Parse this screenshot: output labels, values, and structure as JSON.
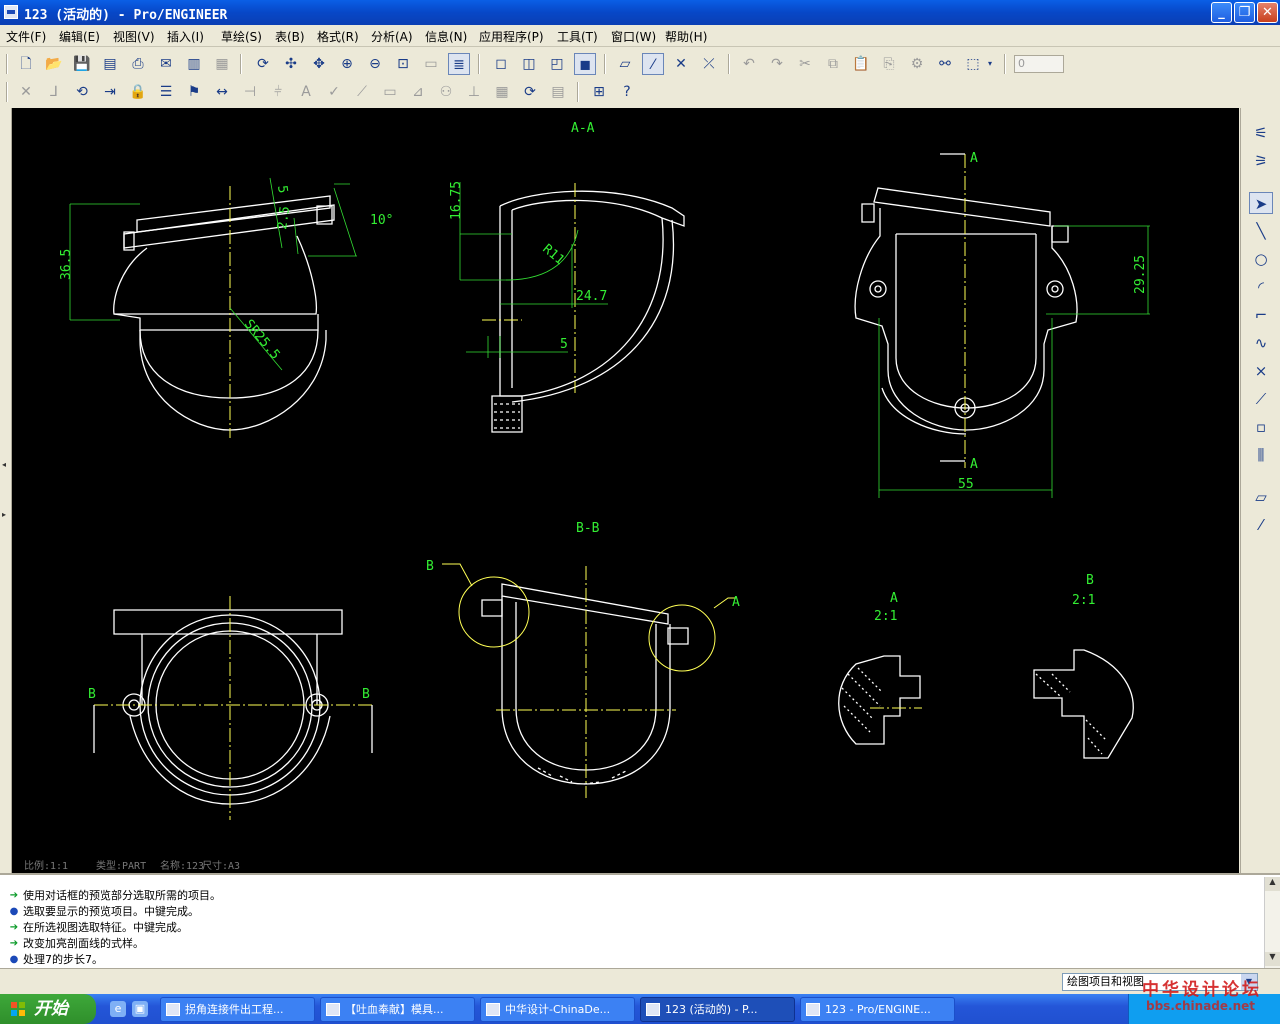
{
  "window": {
    "title": "123 (活动的) - Pro/ENGINEER"
  },
  "menu": [
    "文件(F)",
    "编辑(E)",
    "视图(V)",
    "插入(I)",
    "草绘(S)",
    "表(B)",
    "格式(R)",
    "分析(A)",
    "信息(N)",
    "应用程序(P)",
    "工具(T)",
    "窗口(W)",
    "帮助(H)"
  ],
  "toolbar": {
    "scale_spin_value": "0"
  },
  "drawing": {
    "views": {
      "top_left": {
        "dims": [
          "36.5",
          "5",
          "2.5",
          "10°",
          "SR25.5"
        ]
      },
      "section_aa": {
        "title": "A-A",
        "dims": [
          "16.75",
          "R11",
          "24.7",
          "5"
        ]
      },
      "top_right": {
        "dims": [
          "29.25",
          "55"
        ],
        "section_labels": [
          "A",
          "A"
        ]
      },
      "bottom_left": {
        "section_labels": [
          "B",
          "B"
        ]
      },
      "section_bb": {
        "title": "B-B",
        "callouts": [
          "B",
          "A"
        ]
      },
      "detail_a": {
        "name": "A",
        "scale": "2:1"
      },
      "detail_b": {
        "name": "B",
        "scale": "2:1"
      }
    },
    "footer": {
      "scale": "比例:1:1",
      "type": "类型:PART",
      "name": "名称:123",
      "size": "尺寸:A3"
    }
  },
  "messages": [
    {
      "kind": "prompt",
      "text": "使用对话框的预览部分选取所需的项目。"
    },
    {
      "kind": "bullet",
      "text": "选取要显示的预览项目。中键完成。"
    },
    {
      "kind": "prompt",
      "text": "在所选视图选取特征。中键完成。"
    },
    {
      "kind": "prompt",
      "text": "改变加亮剖面线的式样。"
    },
    {
      "kind": "bullet",
      "text": "处理7的步长7。"
    }
  ],
  "status": {
    "selection_filter": "绘图项目和视图"
  },
  "taskbar": {
    "start_label": "开始",
    "tasks": [
      "拐角连接件出工程...",
      "【吐血奉献】模具...",
      "中华设计-ChinaDe...",
      "123 (活动的) - P...",
      "123 - Pro/ENGINE..."
    ]
  },
  "watermark": {
    "title": "中华设计论坛",
    "url": "bbs.chinade.net"
  }
}
